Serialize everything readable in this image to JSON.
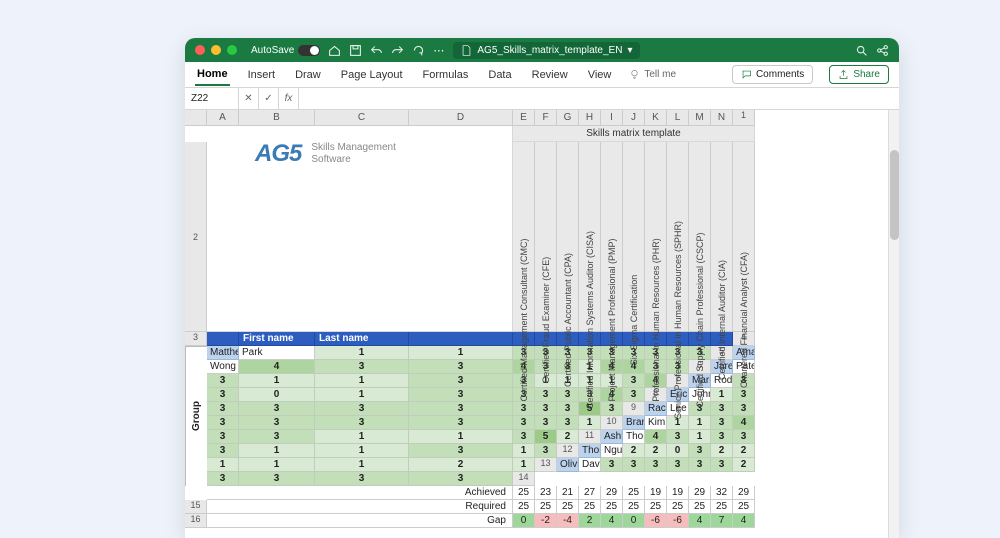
{
  "titlebar": {
    "autosave": "AutoSave",
    "filename": "AG5_Skills_matrix_template_EN"
  },
  "ribbon": {
    "tabs": [
      "Home",
      "Insert",
      "Draw",
      "Page Layout",
      "Formulas",
      "Data",
      "Review",
      "View"
    ],
    "tellme": "Tell me",
    "comments": "Comments",
    "share": "Share"
  },
  "formula": {
    "cellref": "Z22",
    "fx": "fx"
  },
  "columns": [
    "",
    "A",
    "B",
    "C",
    "D",
    "E",
    "F",
    "G",
    "H",
    "I",
    "J",
    "K",
    "L",
    "M",
    "N"
  ],
  "logo": {
    "brand": "AG5",
    "line1": "Skills Management",
    "line2": "Software"
  },
  "title": "Skills matrix template",
  "skills": [
    "Certified Management Consultant (CMC)",
    "Certified Fraud Examiner (CFE)",
    "Certified Public Accountant (CPA)",
    "Certified Information Systems Auditor (CISA)",
    "Project Management Professional (PMP)",
    "Six Sigma Certification",
    "Professional in Human Resources (PHR)",
    "Senior Professional in Human Resources (SPHR)",
    "Certified Supply Chain Professional (CSCP)",
    "Certified Internal Auditor (CIA)",
    "Chartered Financial Analyst (CFA)"
  ],
  "headers": {
    "first": "First name",
    "last": "Last name",
    "group": "Group"
  },
  "people": [
    {
      "first": "Matthew",
      "last": "Park",
      "v": [
        1,
        1,
        3,
        3,
        3,
        3,
        3,
        3,
        3,
        3,
        3
      ]
    },
    {
      "first": "Amanda",
      "last": "Wong",
      "v": [
        4,
        3,
        3,
        4,
        3,
        3,
        1,
        4,
        4,
        3,
        3
      ]
    },
    {
      "first": "Jared",
      "last": "Patel",
      "v": [
        3,
        1,
        1,
        3,
        3,
        1,
        1,
        1,
        1,
        3,
        4
      ]
    },
    {
      "first": "Maria",
      "last": "Rodriguez",
      "v": [
        3,
        3,
        0,
        1,
        3,
        3,
        3,
        3,
        3,
        4,
        3
      ]
    },
    {
      "first": "Eric",
      "last": "Johnson",
      "v": [
        1,
        3,
        3,
        3,
        3,
        3,
        3,
        3,
        3,
        5,
        3
      ]
    },
    {
      "first": "Rachel",
      "last": "Lee",
      "v": [
        3,
        3,
        3,
        3,
        3,
        3,
        3,
        3,
        3,
        3,
        1
      ]
    },
    {
      "first": "Brandon",
      "last": "Kim",
      "v": [
        1,
        1,
        3,
        4,
        3,
        3,
        1,
        1,
        3,
        5,
        2
      ]
    },
    {
      "first": "Ashley",
      "last": "Thompson",
      "v": [
        4,
        3,
        1,
        3,
        3,
        3,
        1,
        1,
        3,
        1,
        3
      ]
    },
    {
      "first": "Thomas",
      "last": "Nguyen",
      "v": [
        2,
        2,
        0,
        3,
        2,
        2,
        1,
        1,
        1,
        2,
        1
      ]
    },
    {
      "first": "Olivia",
      "last": "Davis",
      "v": [
        3,
        3,
        3,
        3,
        3,
        3,
        2,
        3,
        3,
        3,
        3
      ]
    }
  ],
  "summary": {
    "achieved": {
      "label": "Achieved",
      "v": [
        25,
        23,
        21,
        27,
        29,
        25,
        19,
        19,
        29,
        32,
        29
      ]
    },
    "required": {
      "label": "Required",
      "v": [
        25,
        25,
        25,
        25,
        25,
        25,
        25,
        25,
        25,
        25,
        25
      ]
    },
    "gap": {
      "label": "Gap",
      "v": [
        0,
        -2,
        -4,
        2,
        4,
        0,
        -6,
        -6,
        4,
        7,
        4
      ]
    }
  }
}
